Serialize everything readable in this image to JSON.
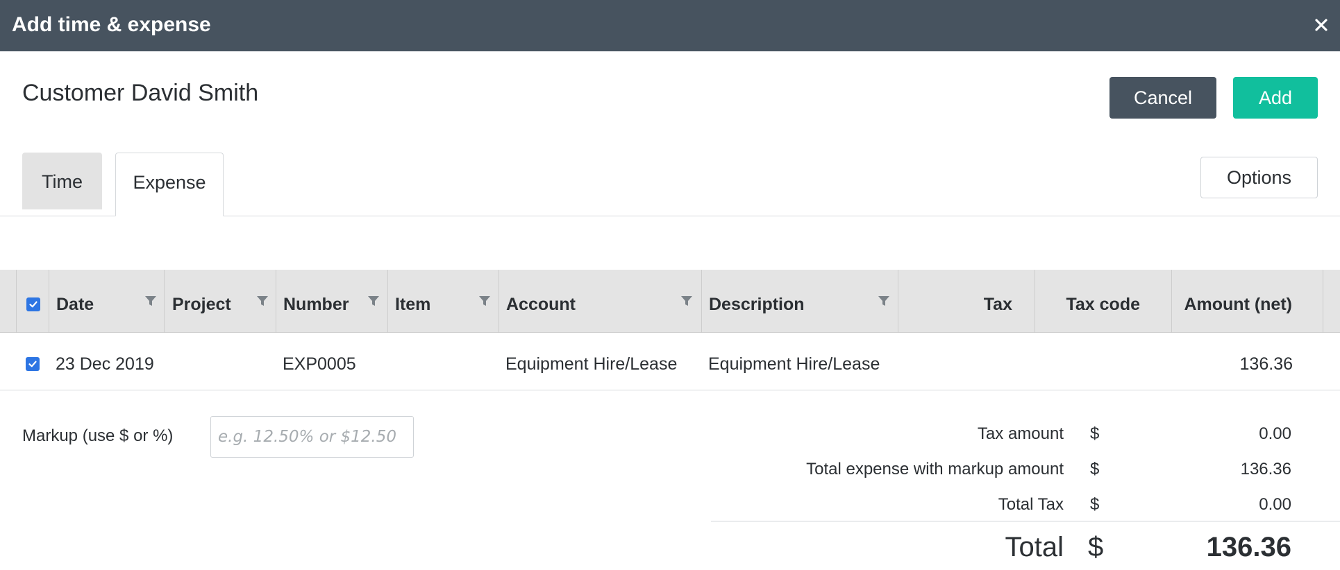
{
  "dialog": {
    "title": "Add time & expense"
  },
  "header": {
    "customer": "Customer David Smith",
    "cancel_label": "Cancel",
    "add_label": "Add",
    "options_label": "Options"
  },
  "tabs": [
    {
      "label": "Time",
      "active": false
    },
    {
      "label": "Expense",
      "active": true
    }
  ],
  "table": {
    "columns": [
      "Date",
      "Project",
      "Number",
      "Item",
      "Account",
      "Description",
      "Tax",
      "Tax code",
      "Amount (net)"
    ],
    "rows": [
      {
        "checked": true,
        "date": "23 Dec 2019",
        "project": "",
        "number": "EXP0005",
        "item": "",
        "account": "Equipment Hire/Lease",
        "description": "Equipment Hire/Lease",
        "tax": "",
        "tax_code": "",
        "amount": "136.36"
      }
    ]
  },
  "markup": {
    "label": "Markup (use $ or %)",
    "placeholder": "e.g. 12.50% or $12.50"
  },
  "summary": {
    "currency": "$",
    "rows": [
      {
        "label": "Tax amount",
        "value": "0.00"
      },
      {
        "label": "Total expense with markup amount",
        "value": "136.36"
      },
      {
        "label": "Total Tax",
        "value": "0.00"
      }
    ],
    "total_label": "Total",
    "total_value": "136.36"
  },
  "colors": {
    "titlebar": "#47535f",
    "cancel": "#47535f",
    "add": "#11bf9d",
    "checkbox": "#2d75e3"
  }
}
